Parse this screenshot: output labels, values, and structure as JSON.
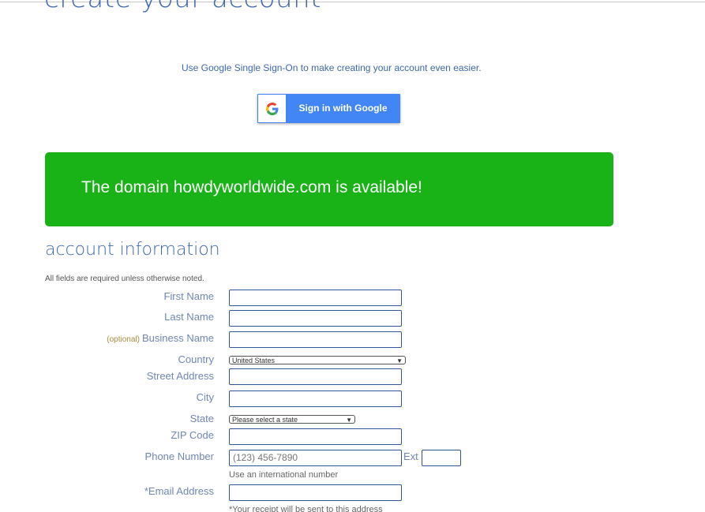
{
  "page": {
    "title": "create your account",
    "sso_text": "Use Google Single Sign-On to make creating your account even easier.",
    "google_button_label": "Sign in with Google",
    "domain_message": "The domain howdyworldwide.com is available!"
  },
  "section": {
    "title": "account information",
    "note": "All fields are required unless otherwise noted."
  },
  "form": {
    "first_name_label": "First Name",
    "last_name_label": "Last Name",
    "business_optional": "(optional)",
    "business_name_label": "Business Name",
    "country_label": "Country",
    "country_value": "United States",
    "street_label": "Street Address",
    "city_label": "City",
    "state_label": "State",
    "state_value": "Please select a state",
    "zip_label": "ZIP Code",
    "phone_label": "Phone Number",
    "phone_placeholder": "(123) 456-7890",
    "ext_label": "Ext",
    "phone_helper": "Use an international number",
    "email_label": "*Email Address",
    "email_helper": "*Your receipt will be sent to this address"
  },
  "colors": {
    "accent": "#3f67ad",
    "banner": "#19b217",
    "google_blue": "#4285f4"
  },
  "icons": {
    "google": "google-g-icon",
    "dropdown": "chevron-down-icon"
  }
}
